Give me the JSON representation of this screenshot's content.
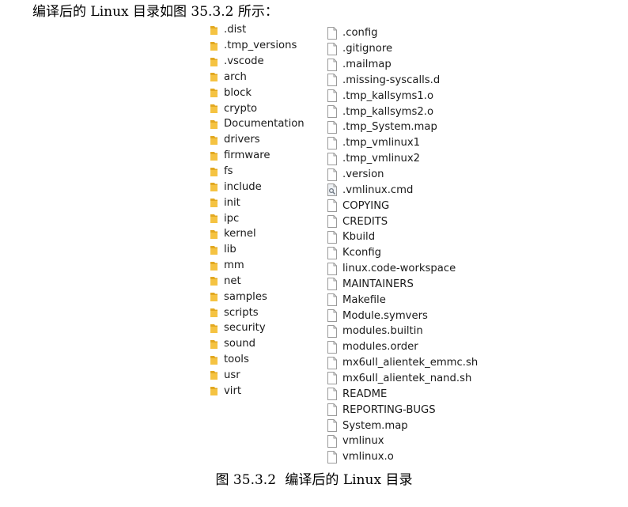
{
  "intro_text": "编译后的 Linux 目录如图 35.3.2 所示：",
  "folders": [
    {
      "name": ".dist",
      "icon": "folder-icon"
    },
    {
      "name": ".tmp_versions",
      "icon": "folder-icon"
    },
    {
      "name": ".vscode",
      "icon": "folder-icon"
    },
    {
      "name": "arch",
      "icon": "folder-icon"
    },
    {
      "name": "block",
      "icon": "folder-icon"
    },
    {
      "name": "crypto",
      "icon": "folder-icon"
    },
    {
      "name": "Documentation",
      "icon": "folder-icon"
    },
    {
      "name": "drivers",
      "icon": "folder-icon"
    },
    {
      "name": "firmware",
      "icon": "folder-icon"
    },
    {
      "name": "fs",
      "icon": "folder-icon"
    },
    {
      "name": "include",
      "icon": "folder-icon"
    },
    {
      "name": "init",
      "icon": "folder-icon"
    },
    {
      "name": "ipc",
      "icon": "folder-icon"
    },
    {
      "name": "kernel",
      "icon": "folder-icon"
    },
    {
      "name": "lib",
      "icon": "folder-icon"
    },
    {
      "name": "mm",
      "icon": "folder-icon"
    },
    {
      "name": "net",
      "icon": "folder-icon"
    },
    {
      "name": "samples",
      "icon": "folder-icon"
    },
    {
      "name": "scripts",
      "icon": "folder-icon"
    },
    {
      "name": "security",
      "icon": "folder-icon"
    },
    {
      "name": "sound",
      "icon": "folder-icon"
    },
    {
      "name": "tools",
      "icon": "folder-icon"
    },
    {
      "name": "usr",
      "icon": "folder-icon"
    },
    {
      "name": "virt",
      "icon": "folder-icon"
    }
  ],
  "files": [
    {
      "name": ".config",
      "icon": "file-icon"
    },
    {
      "name": ".gitignore",
      "icon": "file-icon"
    },
    {
      "name": ".mailmap",
      "icon": "file-icon"
    },
    {
      "name": ".missing-syscalls.d",
      "icon": "file-icon"
    },
    {
      "name": ".tmp_kallsyms1.o",
      "icon": "file-icon"
    },
    {
      "name": ".tmp_kallsyms2.o",
      "icon": "file-icon"
    },
    {
      "name": ".tmp_System.map",
      "icon": "file-icon"
    },
    {
      "name": ".tmp_vmlinux1",
      "icon": "file-icon"
    },
    {
      "name": ".tmp_vmlinux2",
      "icon": "file-icon"
    },
    {
      "name": ".version",
      "icon": "file-icon"
    },
    {
      "name": ".vmlinux.cmd",
      "icon": "cmd-script-icon"
    },
    {
      "name": "COPYING",
      "icon": "file-icon"
    },
    {
      "name": "CREDITS",
      "icon": "file-icon"
    },
    {
      "name": "Kbuild",
      "icon": "file-icon"
    },
    {
      "name": "Kconfig",
      "icon": "file-icon"
    },
    {
      "name": "linux.code-workspace",
      "icon": "file-icon"
    },
    {
      "name": "MAINTAINERS",
      "icon": "file-icon"
    },
    {
      "name": "Makefile",
      "icon": "file-icon"
    },
    {
      "name": "Module.symvers",
      "icon": "file-icon"
    },
    {
      "name": "modules.builtin",
      "icon": "file-icon"
    },
    {
      "name": "modules.order",
      "icon": "file-icon"
    },
    {
      "name": "mx6ull_alientek_emmc.sh",
      "icon": "file-icon"
    },
    {
      "name": "mx6ull_alientek_nand.sh",
      "icon": "file-icon"
    },
    {
      "name": "README",
      "icon": "file-icon"
    },
    {
      "name": "REPORTING-BUGS",
      "icon": "file-icon"
    },
    {
      "name": "System.map",
      "icon": "file-icon"
    },
    {
      "name": "vmlinux",
      "icon": "file-icon"
    },
    {
      "name": "vmlinux.o",
      "icon": "file-icon"
    }
  ],
  "caption": {
    "figure_label": "图 35.3.2",
    "title": "编译后的 Linux 目录"
  },
  "colors": {
    "folder": "#f5c342",
    "folder_dark": "#e2a820",
    "file_border": "#9a9a9a"
  }
}
